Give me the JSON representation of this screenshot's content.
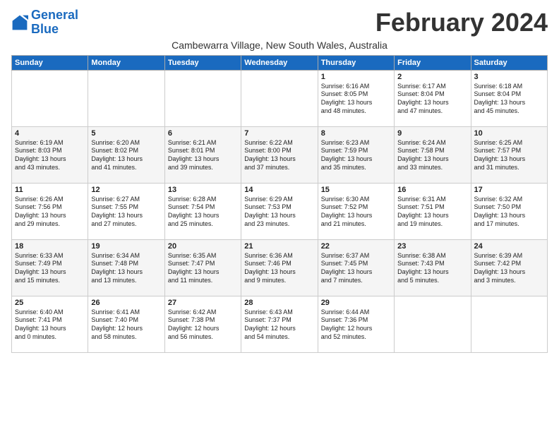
{
  "logo": {
    "line1": "General",
    "line2": "Blue"
  },
  "title": "February 2024",
  "location": "Cambewarra Village, New South Wales, Australia",
  "days_of_week": [
    "Sunday",
    "Monday",
    "Tuesday",
    "Wednesday",
    "Thursday",
    "Friday",
    "Saturday"
  ],
  "weeks": [
    [
      {
        "day": "",
        "info": ""
      },
      {
        "day": "",
        "info": ""
      },
      {
        "day": "",
        "info": ""
      },
      {
        "day": "",
        "info": ""
      },
      {
        "day": "1",
        "info": "Sunrise: 6:16 AM\nSunset: 8:05 PM\nDaylight: 13 hours\nand 48 minutes."
      },
      {
        "day": "2",
        "info": "Sunrise: 6:17 AM\nSunset: 8:04 PM\nDaylight: 13 hours\nand 47 minutes."
      },
      {
        "day": "3",
        "info": "Sunrise: 6:18 AM\nSunset: 8:04 PM\nDaylight: 13 hours\nand 45 minutes."
      }
    ],
    [
      {
        "day": "4",
        "info": "Sunrise: 6:19 AM\nSunset: 8:03 PM\nDaylight: 13 hours\nand 43 minutes."
      },
      {
        "day": "5",
        "info": "Sunrise: 6:20 AM\nSunset: 8:02 PM\nDaylight: 13 hours\nand 41 minutes."
      },
      {
        "day": "6",
        "info": "Sunrise: 6:21 AM\nSunset: 8:01 PM\nDaylight: 13 hours\nand 39 minutes."
      },
      {
        "day": "7",
        "info": "Sunrise: 6:22 AM\nSunset: 8:00 PM\nDaylight: 13 hours\nand 37 minutes."
      },
      {
        "day": "8",
        "info": "Sunrise: 6:23 AM\nSunset: 7:59 PM\nDaylight: 13 hours\nand 35 minutes."
      },
      {
        "day": "9",
        "info": "Sunrise: 6:24 AM\nSunset: 7:58 PM\nDaylight: 13 hours\nand 33 minutes."
      },
      {
        "day": "10",
        "info": "Sunrise: 6:25 AM\nSunset: 7:57 PM\nDaylight: 13 hours\nand 31 minutes."
      }
    ],
    [
      {
        "day": "11",
        "info": "Sunrise: 6:26 AM\nSunset: 7:56 PM\nDaylight: 13 hours\nand 29 minutes."
      },
      {
        "day": "12",
        "info": "Sunrise: 6:27 AM\nSunset: 7:55 PM\nDaylight: 13 hours\nand 27 minutes."
      },
      {
        "day": "13",
        "info": "Sunrise: 6:28 AM\nSunset: 7:54 PM\nDaylight: 13 hours\nand 25 minutes."
      },
      {
        "day": "14",
        "info": "Sunrise: 6:29 AM\nSunset: 7:53 PM\nDaylight: 13 hours\nand 23 minutes."
      },
      {
        "day": "15",
        "info": "Sunrise: 6:30 AM\nSunset: 7:52 PM\nDaylight: 13 hours\nand 21 minutes."
      },
      {
        "day": "16",
        "info": "Sunrise: 6:31 AM\nSunset: 7:51 PM\nDaylight: 13 hours\nand 19 minutes."
      },
      {
        "day": "17",
        "info": "Sunrise: 6:32 AM\nSunset: 7:50 PM\nDaylight: 13 hours\nand 17 minutes."
      }
    ],
    [
      {
        "day": "18",
        "info": "Sunrise: 6:33 AM\nSunset: 7:49 PM\nDaylight: 13 hours\nand 15 minutes."
      },
      {
        "day": "19",
        "info": "Sunrise: 6:34 AM\nSunset: 7:48 PM\nDaylight: 13 hours\nand 13 minutes."
      },
      {
        "day": "20",
        "info": "Sunrise: 6:35 AM\nSunset: 7:47 PM\nDaylight: 13 hours\nand 11 minutes."
      },
      {
        "day": "21",
        "info": "Sunrise: 6:36 AM\nSunset: 7:46 PM\nDaylight: 13 hours\nand 9 minutes."
      },
      {
        "day": "22",
        "info": "Sunrise: 6:37 AM\nSunset: 7:45 PM\nDaylight: 13 hours\nand 7 minutes."
      },
      {
        "day": "23",
        "info": "Sunrise: 6:38 AM\nSunset: 7:43 PM\nDaylight: 13 hours\nand 5 minutes."
      },
      {
        "day": "24",
        "info": "Sunrise: 6:39 AM\nSunset: 7:42 PM\nDaylight: 13 hours\nand 3 minutes."
      }
    ],
    [
      {
        "day": "25",
        "info": "Sunrise: 6:40 AM\nSunset: 7:41 PM\nDaylight: 13 hours\nand 0 minutes."
      },
      {
        "day": "26",
        "info": "Sunrise: 6:41 AM\nSunset: 7:40 PM\nDaylight: 12 hours\nand 58 minutes."
      },
      {
        "day": "27",
        "info": "Sunrise: 6:42 AM\nSunset: 7:38 PM\nDaylight: 12 hours\nand 56 minutes."
      },
      {
        "day": "28",
        "info": "Sunrise: 6:43 AM\nSunset: 7:37 PM\nDaylight: 12 hours\nand 54 minutes."
      },
      {
        "day": "29",
        "info": "Sunrise: 6:44 AM\nSunset: 7:36 PM\nDaylight: 12 hours\nand 52 minutes."
      },
      {
        "day": "",
        "info": ""
      },
      {
        "day": "",
        "info": ""
      }
    ]
  ]
}
